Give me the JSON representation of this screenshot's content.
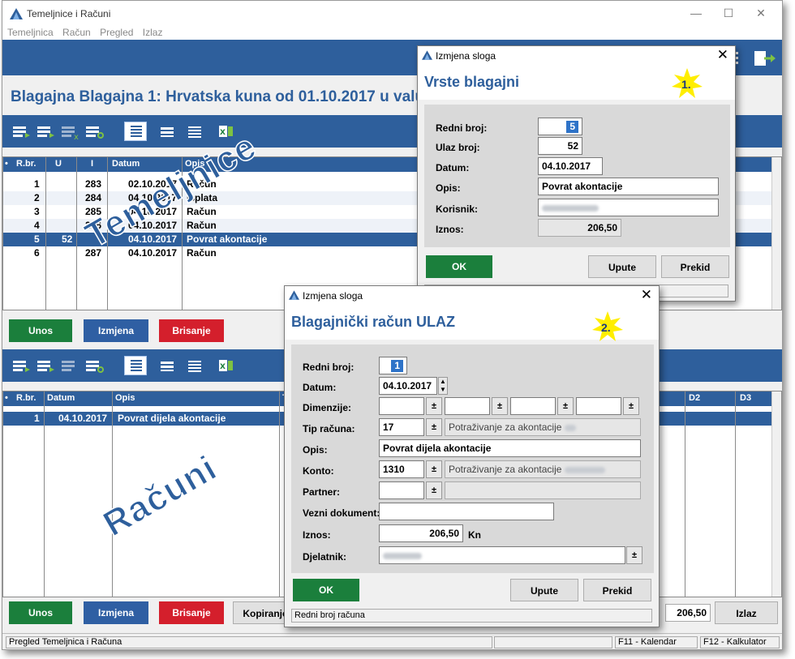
{
  "window": {
    "title": "Temeljnice i Računi",
    "menu": [
      "Temeljnica",
      "Račun",
      "Pregled",
      "Izlaz"
    ],
    "heading": "Blagajna Blagajna 1: Hrvatska kuna od 01.10.2017 u valu"
  },
  "temeljnice_grid": {
    "columns": [
      "R.br.",
      "U",
      "I",
      "Datum",
      "Opis"
    ],
    "rows": [
      {
        "rbr": "1",
        "u": "",
        "i": "283",
        "datum": "02.10.2017",
        "opis": "Račun"
      },
      {
        "rbr": "2",
        "u": "",
        "i": "284",
        "datum": "04.10.2017",
        "opis": "Isplata"
      },
      {
        "rbr": "3",
        "u": "",
        "i": "285",
        "datum": "04.10.2017",
        "opis": "Račun"
      },
      {
        "rbr": "4",
        "u": "",
        "i": "286",
        "datum": "04.10.2017",
        "opis": "Račun"
      },
      {
        "rbr": "5",
        "u": "52",
        "i": "",
        "datum": "04.10.2017",
        "opis": "Povrat akontacije"
      },
      {
        "rbr": "6",
        "u": "",
        "i": "287",
        "datum": "04.10.2017",
        "opis": "Račun"
      }
    ],
    "buttons": {
      "unos": "Unos",
      "izmjena": "Izmjena",
      "brisanje": "Brisanje"
    }
  },
  "racuni_grid": {
    "columns": [
      "R.br.",
      "Datum",
      "Opis",
      "T",
      "D2",
      "D3"
    ],
    "rows": [
      {
        "rbr": "1",
        "datum": "04.10.2017",
        "opis": "Povrat dijela akontacije"
      }
    ],
    "buttons": {
      "unos": "Unos",
      "izmjena": "Izmjena",
      "brisanje": "Brisanje",
      "kopiranje": "Kopiranje",
      "izlaz": "Izlaz"
    },
    "total": "206,50"
  },
  "watermarks": {
    "temeljnice": "Temeljnice",
    "racuni": "Računi"
  },
  "status": {
    "left": "Pregled Temeljnica i Računa",
    "f11": "F11 - Kalendar",
    "f12": "F12 - Kalkulator"
  },
  "dialog1": {
    "title": "Izmjena sloga",
    "heading": "Vrste blagajni",
    "badge": "1.",
    "labels": {
      "redni_broj": "Redni broj:",
      "ulaz_broj": "Ulaz broj:",
      "datum": "Datum:",
      "opis": "Opis:",
      "korisnik": "Korisnik:",
      "iznos": "Iznos:"
    },
    "values": {
      "redni_broj": "5",
      "ulaz_broj": "52",
      "datum": "04.10.2017",
      "opis": "Povrat akontacije",
      "iznos": "206,50"
    },
    "buttons": {
      "ok": "OK",
      "upute": "Upute",
      "prekid": "Prekid"
    }
  },
  "dialog2": {
    "title": "Izmjena sloga",
    "heading": "Blagajnički račun ULAZ",
    "badge": "2.",
    "labels": {
      "redni_broj": "Redni broj:",
      "datum": "Datum:",
      "dimenzije": "Dimenzije:",
      "tip_racuna": "Tip računa:",
      "opis": "Opis:",
      "konto": "Konto:",
      "partner": "Partner:",
      "vezni_dokument": "Vezni dokument:",
      "iznos": "Iznos:",
      "djelatnik": "Djelatnik:"
    },
    "values": {
      "redni_broj": "1",
      "datum": "04.10.2017",
      "tip_racuna": "17",
      "tip_racuna_naziv": "Potraživanje za akontacije",
      "opis": "Povrat dijela akontacije",
      "konto": "1310",
      "konto_naziv": "Potraživanje za akontacije",
      "iznos": "206,50",
      "valuta": "Kn"
    },
    "buttons": {
      "ok": "OK",
      "upute": "Upute",
      "prekid": "Prekid"
    },
    "status": "Redni broj računa"
  },
  "colors": {
    "brand_blue": "#2e5f9c",
    "ok_green": "#1b7f3c",
    "delete_red": "#d41f2c",
    "badge_yellow": "#ffee00"
  }
}
